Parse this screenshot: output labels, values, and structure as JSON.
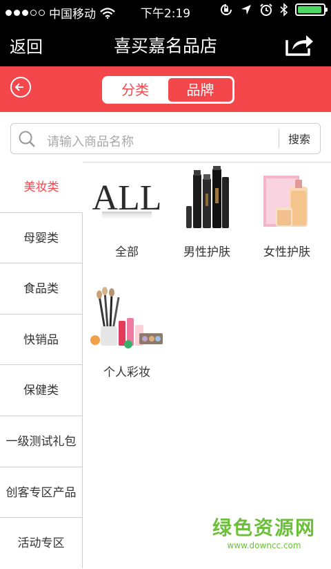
{
  "status_bar": {
    "carrier": "中国移动",
    "time": "下午2:19",
    "battery_level": 0.95
  },
  "nav": {
    "back": "返回",
    "title": "喜买嘉名品店",
    "share_icon": "share-icon"
  },
  "segment": {
    "tab1": "分类",
    "tab2": "品牌",
    "selected": "品牌"
  },
  "search": {
    "placeholder": "请输入商品名称",
    "button": "搜索"
  },
  "sidebar": {
    "items": [
      {
        "label": "美妆类",
        "active": true
      },
      {
        "label": "母婴类"
      },
      {
        "label": "食品类"
      },
      {
        "label": "快销品"
      },
      {
        "label": "保健类"
      },
      {
        "label": "一级测试礼包"
      },
      {
        "label": "创客专区产品"
      },
      {
        "label": "活动专区"
      }
    ]
  },
  "grid": {
    "items": [
      {
        "label": "全部",
        "logo_text": "ALL"
      },
      {
        "label": "男性护肤"
      },
      {
        "label": "女性护肤"
      },
      {
        "label": "个人彩妆"
      }
    ]
  },
  "watermark": {
    "title": "绿色资源网",
    "url": "www.downcc.com"
  },
  "colors": {
    "accent": "#f4474b",
    "header": "#000000",
    "battery": "#4cd964",
    "watermark": "#6cbf3a"
  }
}
